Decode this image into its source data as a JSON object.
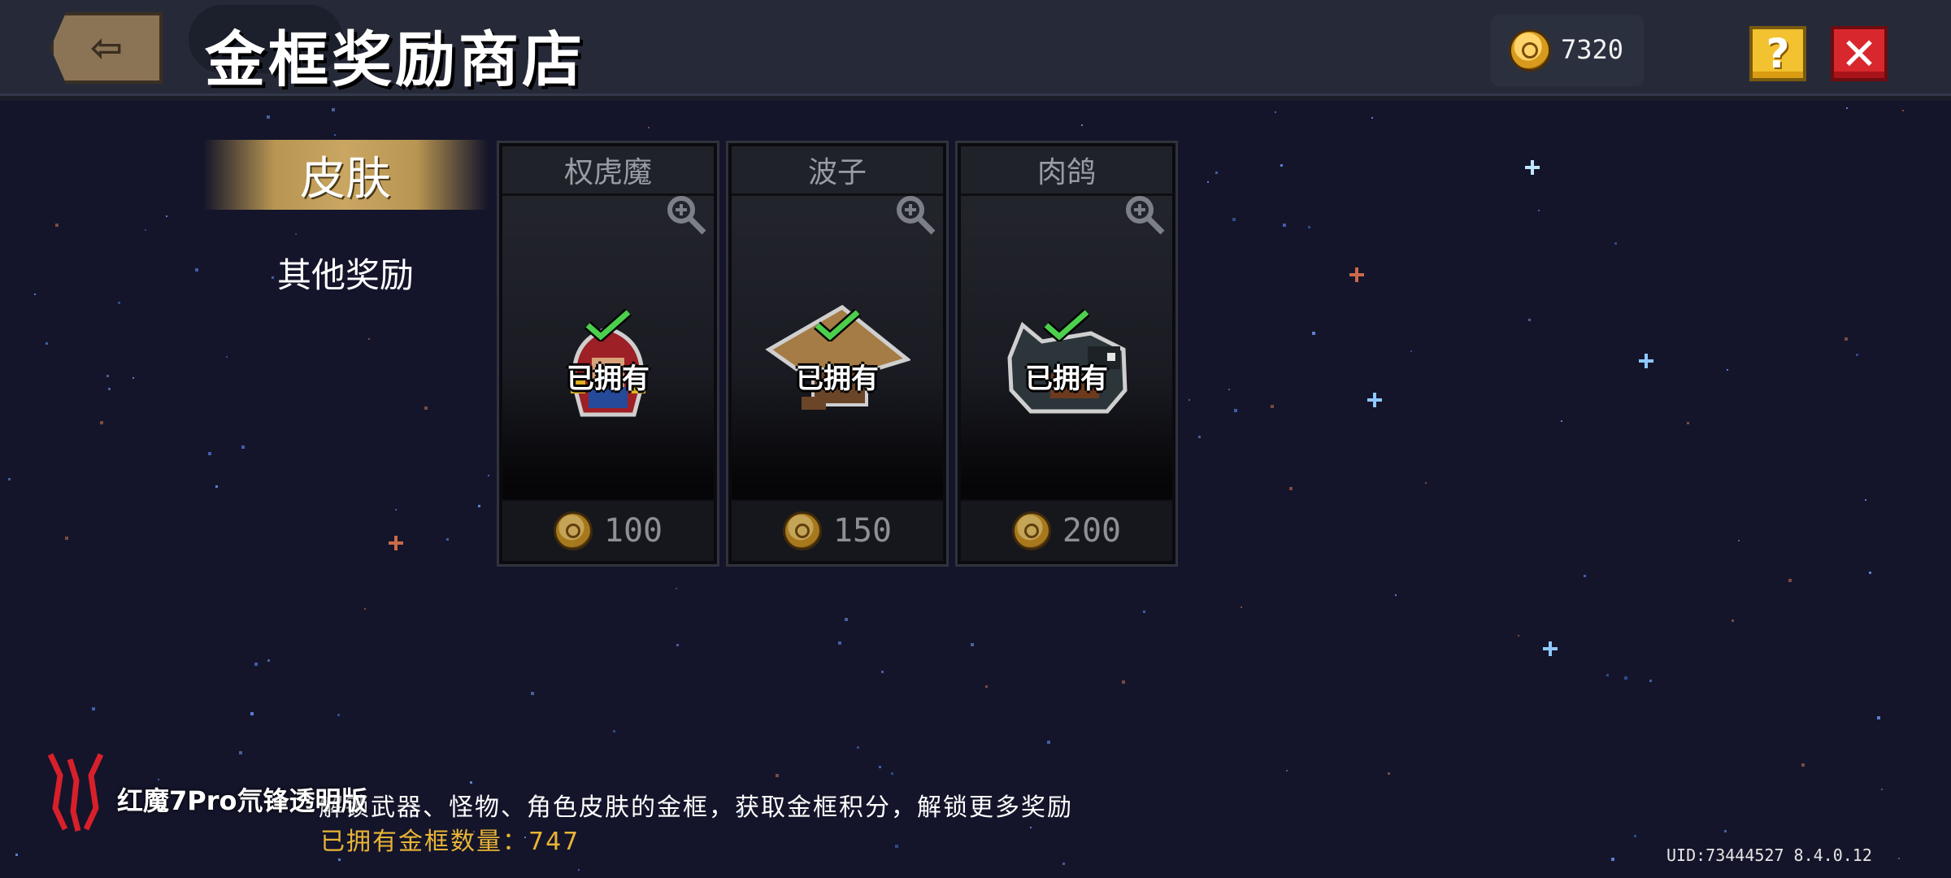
{
  "header": {
    "title": "金框奖励商店",
    "coins": "7320",
    "back_icon": "exit-icon",
    "help_label": "?",
    "close_label": "✕"
  },
  "tabs": [
    {
      "label": "皮肤",
      "active": true
    },
    {
      "label": "其他奖励",
      "active": false
    }
  ],
  "cards": [
    {
      "name": "权虎魔",
      "status": "已拥有",
      "price": "100",
      "sprite": "red-hooded-character"
    },
    {
      "name": "波子",
      "status": "已拥有",
      "price": "150",
      "sprite": "straw-hat-character"
    },
    {
      "name": "肉鸽",
      "status": "已拥有",
      "price": "200",
      "sprite": "crow-character"
    }
  ],
  "footer": {
    "hint": "解锁武器、怪物、角色皮肤的金框，获取金框积分，解锁更多奖励",
    "owned_count": "已拥有金框数量：747",
    "uid": "UID:73444527 8.4.0.12"
  },
  "watermark": {
    "text": "红魔7Pro氘锋透明版"
  },
  "colors": {
    "background": "#14152a",
    "topbar": "#262a38",
    "tab_active": "#b89552",
    "owned_count": "#e9b437",
    "help": "#f2c230",
    "close": "#d8282e"
  }
}
